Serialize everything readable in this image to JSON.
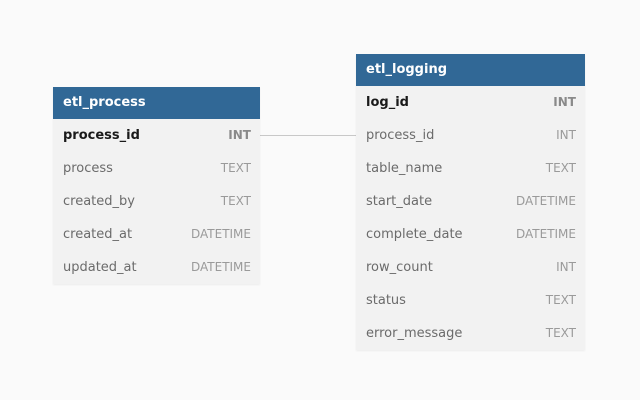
{
  "diagram": {
    "tables": [
      {
        "name": "etl_process",
        "columns": [
          {
            "name": "process_id",
            "type": "INT",
            "primary_key": true
          },
          {
            "name": "process",
            "type": "TEXT",
            "primary_key": false
          },
          {
            "name": "created_by",
            "type": "TEXT",
            "primary_key": false
          },
          {
            "name": "created_at",
            "type": "DATETIME",
            "primary_key": false
          },
          {
            "name": "updated_at",
            "type": "DATETIME",
            "primary_key": false
          }
        ]
      },
      {
        "name": "etl_logging",
        "columns": [
          {
            "name": "log_id",
            "type": "INT",
            "primary_key": true
          },
          {
            "name": "process_id",
            "type": "INT",
            "primary_key": false
          },
          {
            "name": "table_name",
            "type": "TEXT",
            "primary_key": false
          },
          {
            "name": "start_date",
            "type": "DATETIME",
            "primary_key": false
          },
          {
            "name": "complete_date",
            "type": "DATETIME",
            "primary_key": false
          },
          {
            "name": "row_count",
            "type": "INT",
            "primary_key": false
          },
          {
            "name": "status",
            "type": "TEXT",
            "primary_key": false
          },
          {
            "name": "error_message",
            "type": "TEXT",
            "primary_key": false
          }
        ]
      }
    ],
    "relationships": [
      {
        "from": "etl_process.process_id",
        "to": "etl_logging.process_id"
      }
    ]
  },
  "colors": {
    "header_bg": "#316896",
    "header_text": "#ffffff",
    "table_bg": "#f2f2f2",
    "page_bg": "#fafafa",
    "connector": "#c8c8c8"
  }
}
